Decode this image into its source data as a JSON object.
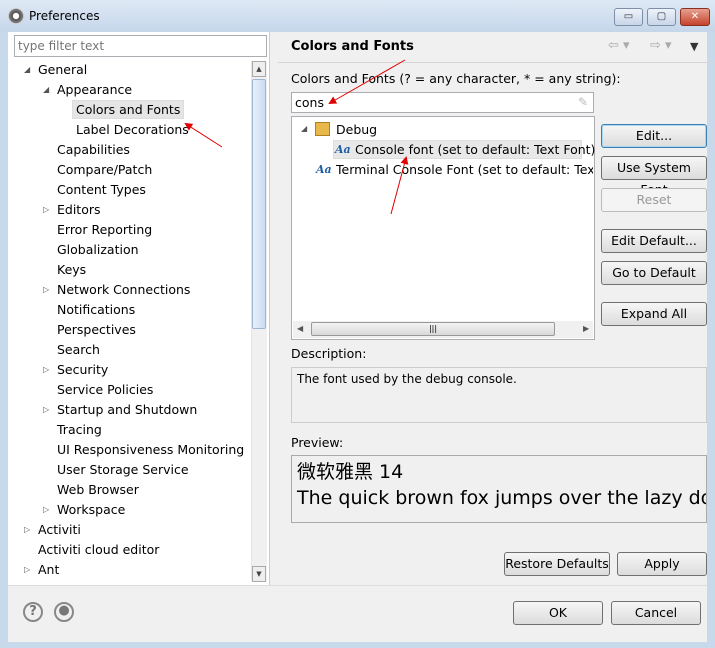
{
  "window": {
    "title": "Preferences",
    "minimize": "▭",
    "maximize": "▢",
    "close": "✕"
  },
  "left": {
    "filter_placeholder": "type filter text",
    "tree": [
      {
        "label": "General",
        "level": 0,
        "expander": "expanded"
      },
      {
        "label": "Appearance",
        "level": 1,
        "expander": "expanded"
      },
      {
        "label": "Colors and Fonts",
        "level": 2,
        "expander": "none",
        "selected": true
      },
      {
        "label": "Label Decorations",
        "level": 2,
        "expander": "none"
      },
      {
        "label": "Capabilities",
        "level": 1,
        "expander": "none"
      },
      {
        "label": "Compare/Patch",
        "level": 1,
        "expander": "none"
      },
      {
        "label": "Content Types",
        "level": 1,
        "expander": "none"
      },
      {
        "label": "Editors",
        "level": 1,
        "expander": "collapsed"
      },
      {
        "label": "Error Reporting",
        "level": 1,
        "expander": "none"
      },
      {
        "label": "Globalization",
        "level": 1,
        "expander": "none"
      },
      {
        "label": "Keys",
        "level": 1,
        "expander": "none"
      },
      {
        "label": "Network Connections",
        "level": 1,
        "expander": "collapsed"
      },
      {
        "label": "Notifications",
        "level": 1,
        "expander": "none"
      },
      {
        "label": "Perspectives",
        "level": 1,
        "expander": "none"
      },
      {
        "label": "Search",
        "level": 1,
        "expander": "none"
      },
      {
        "label": "Security",
        "level": 1,
        "expander": "collapsed"
      },
      {
        "label": "Service Policies",
        "level": 1,
        "expander": "none"
      },
      {
        "label": "Startup and Shutdown",
        "level": 1,
        "expander": "collapsed"
      },
      {
        "label": "Tracing",
        "level": 1,
        "expander": "none"
      },
      {
        "label": "UI Responsiveness Monitoring",
        "level": 1,
        "expander": "none"
      },
      {
        "label": "User Storage Service",
        "level": 1,
        "expander": "none"
      },
      {
        "label": "Web Browser",
        "level": 1,
        "expander": "none"
      },
      {
        "label": "Workspace",
        "level": 1,
        "expander": "collapsed"
      },
      {
        "label": "Activiti",
        "level": 0,
        "expander": "collapsed"
      },
      {
        "label": "Activiti cloud editor",
        "level": 0,
        "expander": "none"
      },
      {
        "label": "Ant",
        "level": 0,
        "expander": "collapsed"
      }
    ]
  },
  "right": {
    "title": "Colors and Fonts",
    "filter_label": "Colors and Fonts (? = any character, * = any string):",
    "filter_value": "cons",
    "list": {
      "category": "Debug",
      "items": [
        {
          "label": "Console font (set to default: Text Font)",
          "selected": true
        },
        {
          "label": "Terminal Console Font (set to default: Text Font)"
        }
      ]
    },
    "buttons": {
      "edit": "Edit...",
      "use_system_font": "Use System Font",
      "reset": "Reset",
      "edit_default": "Edit Default...",
      "go_to_default": "Go to Default",
      "expand_all": "Expand All"
    },
    "description_label": "Description:",
    "description": "The font used by the debug console.",
    "preview_label": "Preview:",
    "preview_line1": "微软雅黑 14",
    "preview_line2": "The quick brown fox jumps over the lazy dog.",
    "restore_defaults": "Restore Defaults",
    "apply": "Apply"
  },
  "footer": {
    "help": "?",
    "ok": "OK",
    "cancel": "Cancel"
  },
  "colors": {
    "annotation_arrow": "#e00000",
    "selection": "#e5e5e5",
    "icon_blue": "#1f5fa5"
  }
}
